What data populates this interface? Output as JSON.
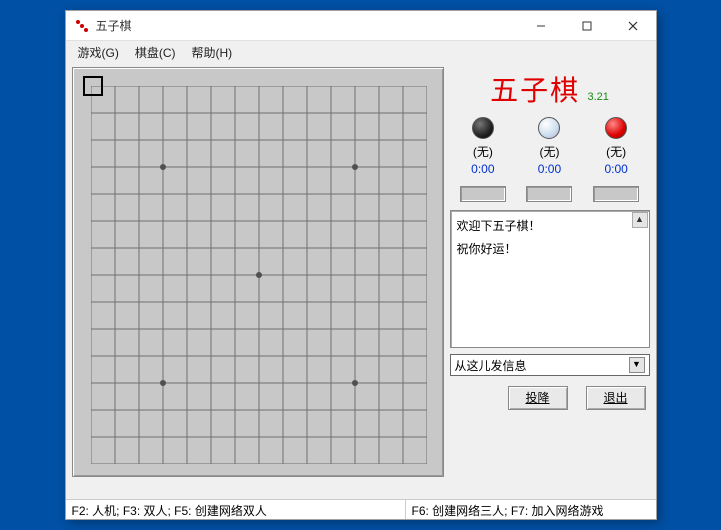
{
  "window": {
    "title": "五子棋"
  },
  "menus": {
    "game": "游戏(G)",
    "board": "棋盘(C)",
    "help": "帮助(H)"
  },
  "header": {
    "title": "五子棋",
    "version": "3.21"
  },
  "players": [
    {
      "name": "(无)",
      "time": "0:00"
    },
    {
      "name": "(无)",
      "time": "0:00"
    },
    {
      "name": "(无)",
      "time": "0:00"
    }
  ],
  "log": {
    "line1": "欢迎下五子棋！",
    "line2": "祝你好运！"
  },
  "chat": {
    "placeholder": "从这儿发信息"
  },
  "buttons": {
    "surrender": "投降",
    "exit": "退出"
  },
  "status": {
    "left": "F2: 人机;  F3: 双人;  F5: 创建网络双人",
    "right": "F6: 创建网络三人;  F7: 加入网络游戏"
  }
}
